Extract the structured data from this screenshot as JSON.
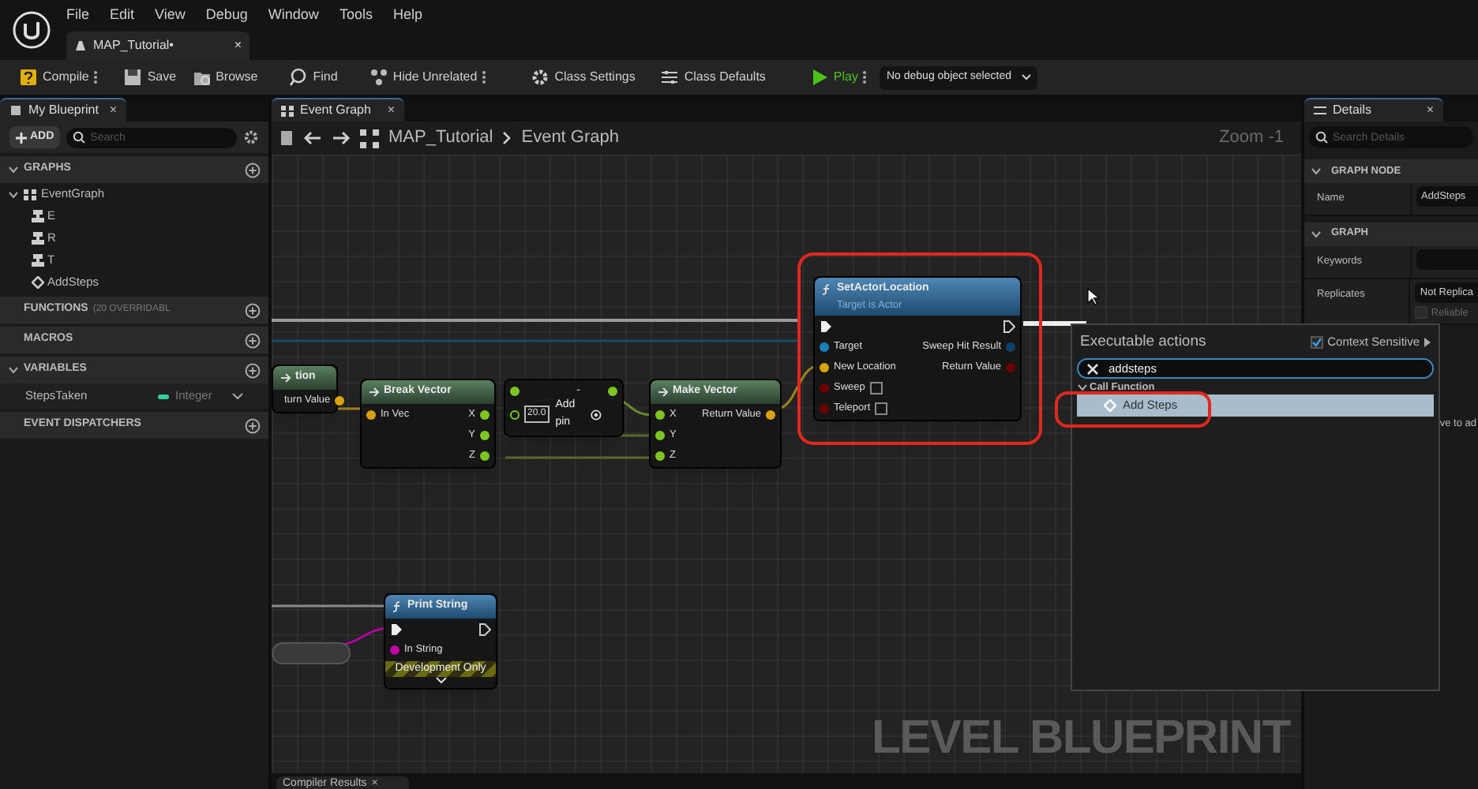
{
  "menu": [
    "File",
    "Edit",
    "View",
    "Debug",
    "Window",
    "Tools",
    "Help"
  ],
  "document_tab": {
    "label": "MAP_Tutorial•",
    "close": "×",
    "selected": true
  },
  "toolbar": [
    {
      "label": "Compile",
      "more": true
    },
    {
      "label": "Save",
      "more": false
    },
    {
      "label": "Browse",
      "more": false
    },
    {
      "label": "Find",
      "more": false
    },
    {
      "label": "Hide Unrelated",
      "more": true
    },
    {
      "label": "Class Settings",
      "more": false
    },
    {
      "label": "Class Defaults",
      "more": false
    },
    {
      "label": "Play",
      "more": true
    }
  ],
  "debug_dropdown": "No debug object selected",
  "my_blueprint": {
    "tab": "My Blueprint",
    "close": "×",
    "add": "ADD",
    "search_placeholder": "Search",
    "sections": [
      {
        "kind": "graphs",
        "title": "GRAPHS",
        "expanded": true,
        "items": [
          {
            "label": "EventGraph",
            "expanded": true,
            "children": [
              {
                "label": "E"
              },
              {
                "label": "R"
              },
              {
                "label": "T"
              },
              {
                "label": "AddSteps"
              }
            ]
          }
        ]
      },
      {
        "kind": "plain",
        "title": "FUNCTIONS",
        "note": "(20 OVERRIDABL"
      },
      {
        "kind": "plain",
        "title": "MACROS"
      },
      {
        "kind": "variables",
        "title": "VARIABLES",
        "expanded": true,
        "variables": [
          {
            "name": "StepsTaken",
            "type": "Integer",
            "color": "#2ed3a0"
          }
        ]
      },
      {
        "kind": "plain",
        "title": "EVENT DISPATCHERS"
      }
    ]
  },
  "graph": {
    "tab": "Event Graph",
    "close": "×",
    "breadcrumb": [
      "MAP_Tutorial",
      "Event Graph"
    ],
    "zoom": "Zoom -1",
    "label": "LEVEL BLUEPRINT",
    "nodes": [
      {
        "kind": "pure",
        "title": "tion",
        "exec": false,
        "outputs": [
          {
            "kind": "data",
            "label": "turn Value",
            "color": "#d9a400"
          }
        ]
      },
      {
        "kind": "pure",
        "title": "Break Vector",
        "exec": false,
        "inputs": [
          {
            "kind": "data",
            "label": "In Vec",
            "color": "#d9a400"
          }
        ],
        "outputs": [
          {
            "kind": "data",
            "label": "X",
            "color": "#7dc520"
          },
          {
            "kind": "data",
            "label": "Y",
            "color": "#7dc520"
          },
          {
            "kind": "data",
            "label": "Z",
            "color": "#7dc520"
          }
        ]
      },
      {
        "kind": "math",
        "title": "-",
        "exec": false,
        "value": "20.0",
        "add_pin": "Add pin",
        "inputs": [
          {
            "kind": "data",
            "color": "#7dc520"
          }
        ],
        "outputs": [
          {
            "kind": "data",
            "color": "#7dc520"
          }
        ]
      },
      {
        "kind": "pure",
        "title": "Make Vector",
        "exec": false,
        "inputs": [
          {
            "kind": "data",
            "label": "X",
            "color": "#7dc520"
          },
          {
            "kind": "data",
            "label": "Y",
            "color": "#7dc520"
          },
          {
            "kind": "data",
            "label": "Z",
            "color": "#7dc520"
          }
        ],
        "outputs": [
          {
            "kind": "data",
            "label": "Return Value",
            "color": "#d9a400"
          }
        ]
      },
      {
        "kind": "function",
        "title": "SetActorLocation",
        "subtitle": "Target is Actor",
        "exec": true,
        "inputs": [
          {
            "kind": "data",
            "label": "Target",
            "color": "#1a7fb8"
          },
          {
            "kind": "data",
            "label": "New Location",
            "color": "#d9a400"
          },
          {
            "kind": "checkbox",
            "label": "Sweep",
            "color": "#6a0000",
            "checked": false
          },
          {
            "kind": "checkbox",
            "label": "Teleport",
            "color": "#6a0000",
            "checked": false
          }
        ],
        "outputs": [
          {
            "kind": "data",
            "label": "Sweep Hit Result",
            "color": "#10406a"
          },
          {
            "kind": "data",
            "label": "Return Value",
            "color": "#6a0000"
          }
        ]
      },
      {
        "kind": "function",
        "title": "Print String",
        "exec": true,
        "footer": "Development Only",
        "inputs": [
          {
            "kind": "data",
            "label": "In String",
            "color": "#c000a0"
          }
        ]
      }
    ]
  },
  "action_menu": {
    "title": "Executable actions",
    "context_sensitive": {
      "label": "Context Sensitive",
      "checked": true
    },
    "search": "addsteps",
    "categories": [
      {
        "label": "Call Function",
        "expanded": true,
        "items": [
          {
            "label": "Add Steps",
            "selected": true
          }
        ]
      }
    ]
  },
  "details": {
    "tab": "Details",
    "close": "×",
    "search_placeholder": "Search Details",
    "sections": [
      {
        "title": "GRAPH NODE",
        "expanded": true,
        "rows": [
          {
            "label": "Name",
            "value": "AddSteps"
          }
        ]
      },
      {
        "title": "GRAPH",
        "expanded": true,
        "rows": [
          {
            "label": "Keywords",
            "value": ""
          },
          {
            "label": "Replicates",
            "value": "Not Replica",
            "checkbox": {
              "label": "Reliable",
              "checked": false
            }
          }
        ]
      }
    ],
    "note": "ve to ad"
  },
  "bottom_tab": {
    "label": "Compiler Results",
    "close": "×"
  }
}
